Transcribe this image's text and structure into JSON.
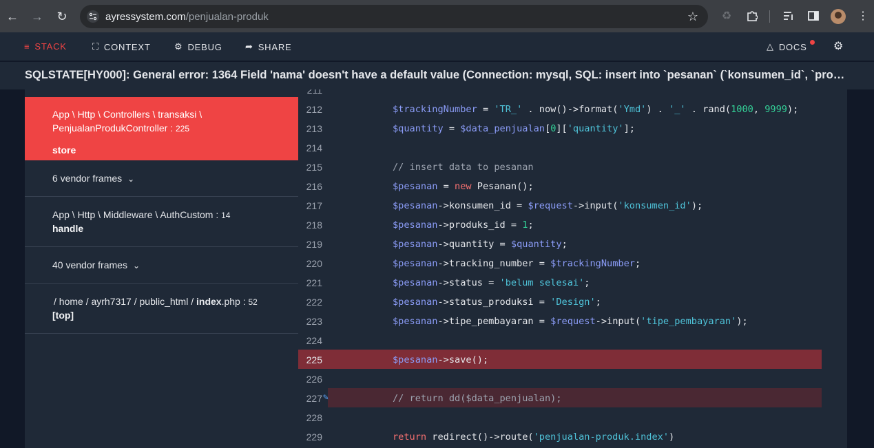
{
  "browser": {
    "url_domain": "ayressystem.com",
    "url_path": "/penjualan-produk"
  },
  "nav": {
    "tabs": [
      "STACK",
      "CONTEXT",
      "DEBUG",
      "SHARE"
    ],
    "docs_label": "DOCS"
  },
  "error": {
    "message": "SQLSTATE[HY000]: General error: 1364 Field 'nama' doesn't have a default value (Connection: mysql, SQL: insert into `pesanan` (`konsumen_id`, `produks_id`, `quantity`, `tracking_number`, `status`, `status_produksi`, `tipe_pembayaran`"
  },
  "stack": {
    "frame1": {
      "class_line1": "App \\ Http \\ Controllers \\ transaksi \\",
      "class_line2": "PenjualanProdukController",
      "line": "225",
      "method": "store"
    },
    "vendor1": "6 vendor frames",
    "frame2": {
      "class": "App \\ Http \\ Middleware \\ AuthCustom",
      "line": "14",
      "method": "handle"
    },
    "vendor2": "40 vendor frames",
    "frame3": {
      "path_prefix": "/ home / ayrh7317 / public_html /",
      "file": "index",
      "ext": ".php",
      "line": "52",
      "method": "[top]"
    }
  },
  "code": {
    "highlight_line": 225,
    "lines": [
      {
        "no": "211",
        "text": ""
      },
      {
        "no": "212",
        "text": "$trackingNumber = 'TR_' . now()->format('Ymd') . '_' . rand(1000, 9999);"
      },
      {
        "no": "213",
        "text": "$quantity = $data_penjualan[0]['quantity'];"
      },
      {
        "no": "214",
        "text": ""
      },
      {
        "no": "215",
        "text": "// insert data to pesanan"
      },
      {
        "no": "216",
        "text": "$pesanan = new Pesanan();"
      },
      {
        "no": "217",
        "text": "$pesanan->konsumen_id = $request->input('konsumen_id');"
      },
      {
        "no": "218",
        "text": "$pesanan->produks_id = 1;"
      },
      {
        "no": "219",
        "text": "$pesanan->quantity = $quantity;"
      },
      {
        "no": "220",
        "text": "$pesanan->tracking_number = $trackingNumber;"
      },
      {
        "no": "221",
        "text": "$pesanan->status = 'belum selesai';"
      },
      {
        "no": "222",
        "text": "$pesanan->status_produksi = 'Design';"
      },
      {
        "no": "223",
        "text": "$pesanan->tipe_pembayaran = $request->input('tipe_pembayaran');"
      },
      {
        "no": "224",
        "text": ""
      },
      {
        "no": "225",
        "text": "$pesanan->save();"
      },
      {
        "no": "226",
        "text": ""
      },
      {
        "no": "227",
        "text": "// return dd($data_penjualan);"
      },
      {
        "no": "228",
        "text": ""
      },
      {
        "no": "229",
        "text": "return redirect()->route('penjualan-produk.index')"
      }
    ]
  }
}
